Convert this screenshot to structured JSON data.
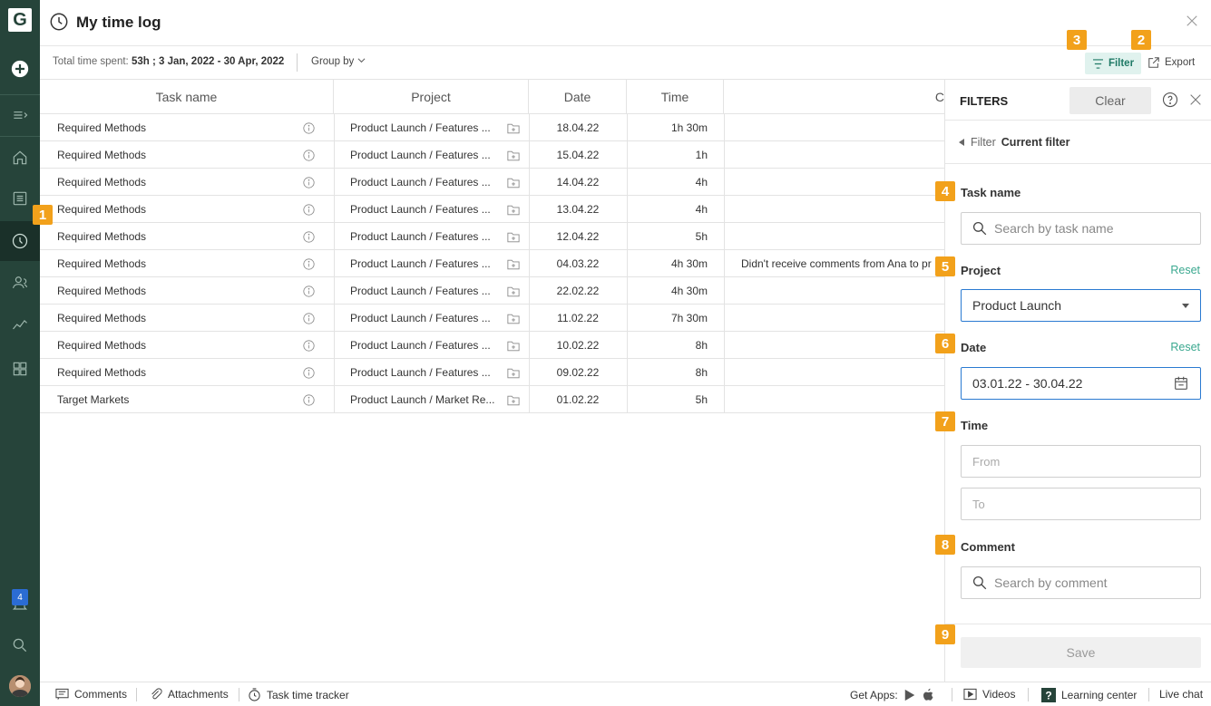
{
  "app": {
    "logo_letter": "G",
    "window_title": "My time log",
    "notification_count": "4"
  },
  "toolbar": {
    "total_label": "Total time spent:",
    "total_value": "53h",
    "date_range": "3 Jan, 2022 - 30 Apr, 2022",
    "group_by": "Group by",
    "filter_label": "Filter",
    "export_label": "Export"
  },
  "table": {
    "headers": [
      "Task name",
      "Project",
      "Date",
      "Time",
      "C"
    ],
    "rows": [
      {
        "task": "Required Methods",
        "project": "Product Launch / Features ...",
        "date": "18.04.22",
        "time": "1h 30m",
        "comment": ""
      },
      {
        "task": "Required Methods",
        "project": "Product Launch / Features ...",
        "date": "15.04.22",
        "time": "1h",
        "comment": ""
      },
      {
        "task": "Required Methods",
        "project": "Product Launch / Features ...",
        "date": "14.04.22",
        "time": "4h",
        "comment": ""
      },
      {
        "task": "Required Methods",
        "project": "Product Launch / Features ...",
        "date": "13.04.22",
        "time": "4h",
        "comment": ""
      },
      {
        "task": "Required Methods",
        "project": "Product Launch / Features ...",
        "date": "12.04.22",
        "time": "5h",
        "comment": ""
      },
      {
        "task": "Required Methods",
        "project": "Product Launch / Features ...",
        "date": "04.03.22",
        "time": "4h 30m",
        "comment": "Didn't receive comments from Ana to pr"
      },
      {
        "task": "Required Methods",
        "project": "Product Launch / Features ...",
        "date": "22.02.22",
        "time": "4h 30m",
        "comment": ""
      },
      {
        "task": "Required Methods",
        "project": "Product Launch / Features ...",
        "date": "11.02.22",
        "time": "7h 30m",
        "comment": ""
      },
      {
        "task": "Required Methods",
        "project": "Product Launch / Features ...",
        "date": "10.02.22",
        "time": "8h",
        "comment": ""
      },
      {
        "task": "Required Methods",
        "project": "Product Launch / Features ...",
        "date": "09.02.22",
        "time": "8h",
        "comment": ""
      },
      {
        "task": "Target Markets",
        "project": "Product Launch / Market Re...",
        "date": "01.02.22",
        "time": "5h",
        "comment": ""
      }
    ]
  },
  "filters": {
    "title": "FILTERS",
    "clear": "Clear",
    "crumb_parent": "Filter",
    "crumb_current": "Current filter",
    "task_name_label": "Task name",
    "task_name_placeholder": "Search by task name",
    "project_label": "Project",
    "project_reset": "Reset",
    "project_value": "Product Launch",
    "date_label": "Date",
    "date_reset": "Reset",
    "date_value": "03.01.22 - 30.04.22",
    "time_label": "Time",
    "time_from_placeholder": "From",
    "time_to_placeholder": "To",
    "comment_label": "Comment",
    "comment_placeholder": "Search by comment",
    "save": "Save"
  },
  "footer": {
    "comments": "Comments",
    "attachments": "Attachments",
    "task_time_tracker": "Task time tracker",
    "get_apps": "Get Apps:",
    "videos": "Videos",
    "learning_center": "Learning center",
    "live_chat": "Live chat"
  },
  "callouts": [
    "1",
    "2",
    "3",
    "4",
    "5",
    "6",
    "7",
    "8",
    "9"
  ],
  "colors": {
    "rail": "#26443a",
    "accent": "#3aa88f",
    "callout": "#f2a11b",
    "focus": "#2a7ad1"
  }
}
